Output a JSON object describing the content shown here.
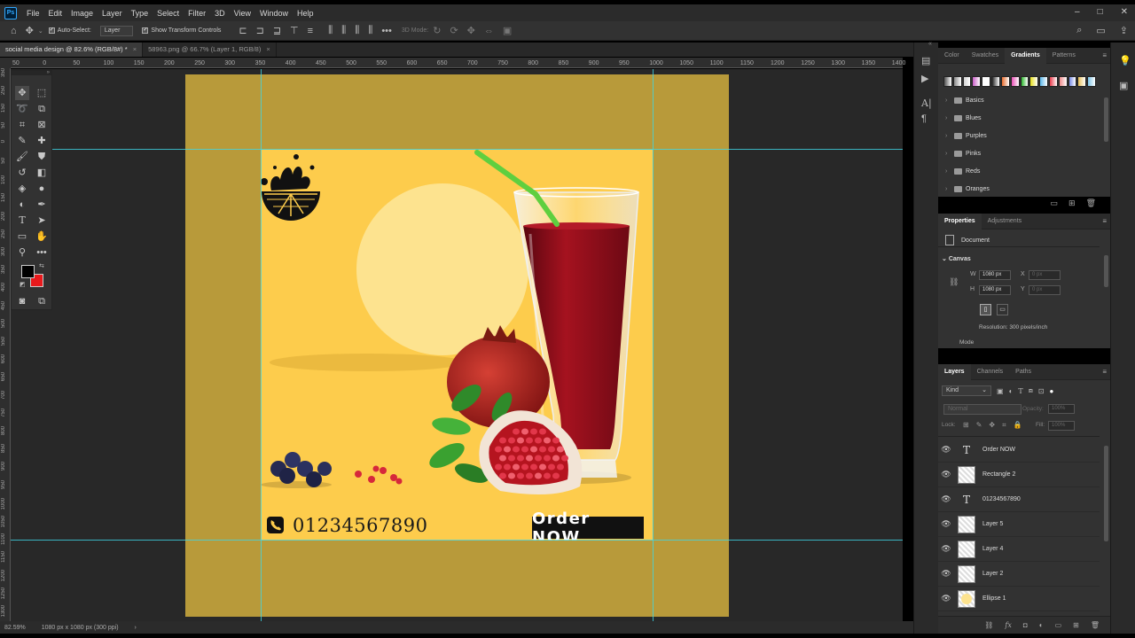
{
  "app": {
    "logo": "Ps"
  },
  "menu": [
    "File",
    "Edit",
    "Image",
    "Layer",
    "Type",
    "Select",
    "Filter",
    "3D",
    "View",
    "Window",
    "Help"
  ],
  "window_controls": {
    "minimize": "–",
    "maximize": "□",
    "close": "✕"
  },
  "options_bar": {
    "auto_select_label": "Auto-Select:",
    "auto_select_target": "Layer",
    "show_transform_label": "Show Transform Controls",
    "mode_3d_label": "3D Mode:"
  },
  "doc_tabs": [
    {
      "label": "social media design @ 82.6% (RGB/8#) *",
      "active": true
    },
    {
      "label": "58963.png @ 66.7% (Layer 1, RGB/8)",
      "active": false
    }
  ],
  "ruler": {
    "h_ticks": [
      "50",
      "0",
      "50",
      "100",
      "150",
      "200",
      "250",
      "300",
      "350",
      "400",
      "450",
      "500",
      "550",
      "600",
      "650",
      "700",
      "750",
      "800",
      "850",
      "900",
      "950",
      "1000",
      "1050",
      "1100",
      "1150",
      "1200",
      "1250",
      "1300",
      "1350",
      "1400"
    ],
    "v_ticks": [
      "350",
      "250",
      "150",
      "50",
      "0",
      "50",
      "100",
      "150",
      "200",
      "250",
      "300",
      "350",
      "400",
      "450",
      "500",
      "550",
      "600",
      "650",
      "700",
      "750",
      "800",
      "850",
      "900",
      "950",
      "1000",
      "1050",
      "1100",
      "1150",
      "1200",
      "1250",
      "1300"
    ]
  },
  "status": {
    "zoom": "82.59%",
    "doc_info": "1080 px x 1080 px (300 ppi)",
    "arrow": "›"
  },
  "artwork": {
    "phone_number": "01234567890",
    "order_button": "Order NOW",
    "colors": {
      "background": "#b89a3a",
      "artboard": "#fdcc4c",
      "juice": "#8e0f1c",
      "straw": "#5fcf3f",
      "circle": "#fde38f"
    }
  },
  "tools": {
    "fg_color": "#000000",
    "bg_color": "#e8191c"
  },
  "gradients_panel": {
    "tabs": [
      "Color",
      "Swatches",
      "Gradients",
      "Patterns"
    ],
    "active_tab": "Gradients",
    "presets": [
      "#555555",
      "#888888",
      "#d0d0d0",
      "#c95cc7",
      "#ffffff",
      "#2a2a2a",
      "#e66b2c",
      "#ea4fb6",
      "#2db82d",
      "#e8e11e",
      "#5ab6ea",
      "#e83a4a",
      "#ef8c8c",
      "#7a8ee6",
      "#e8c15a",
      "#7ec5e8"
    ],
    "folders": [
      "Basics",
      "Blues",
      "Purples",
      "Pinks",
      "Reds",
      "Oranges"
    ]
  },
  "properties_panel": {
    "tabs": [
      "Properties",
      "Adjustments"
    ],
    "doc_label": "Document",
    "section": "Canvas",
    "w_label": "W",
    "w_value": "1080 px",
    "h_label": "H",
    "h_value": "1080 px",
    "x_label": "X",
    "x_value": "0 px",
    "y_label": "Y",
    "y_value": "0 px",
    "resolution": "Resolution: 300 pixels/inch",
    "mode_label": "Mode"
  },
  "layers_panel": {
    "tabs": [
      "Layers",
      "Channels",
      "Paths"
    ],
    "filter_kind": "Kind",
    "blend_mode": "Normal",
    "opacity_label": "Opacity:",
    "opacity_value": "100%",
    "lock_label": "Lock:",
    "fill_label": "Fill:",
    "fill_value": "100%",
    "layers": [
      {
        "name": "Order NOW",
        "type": "text"
      },
      {
        "name": "Rectangle 2",
        "type": "shape"
      },
      {
        "name": "01234567890",
        "type": "text"
      },
      {
        "name": "Layer 5",
        "type": "pixel"
      },
      {
        "name": "Layer 4",
        "type": "pixel"
      },
      {
        "name": "Layer 2",
        "type": "pixel"
      },
      {
        "name": "Ellipse 1",
        "type": "shape"
      }
    ]
  }
}
